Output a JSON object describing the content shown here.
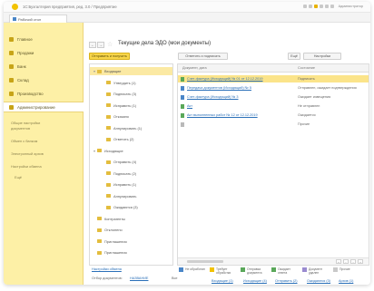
{
  "app": {
    "title": "1С:Бухгалтерия предприятия, ред. 3.0 / Предприятие",
    "user": "Администратор",
    "tab_label": "Рабочий стол"
  },
  "sidebar": {
    "items": [
      {
        "label": "Главное"
      },
      {
        "label": "Продажи"
      },
      {
        "label": "Банк"
      },
      {
        "label": "Склад"
      },
      {
        "label": "Производство"
      },
      {
        "label": "Администрирование"
      }
    ],
    "links": [
      "Общие настройки",
      "документов",
      "Обмен с банком",
      "Электронный архив",
      "Настройки обмена",
      "Ещё"
    ]
  },
  "main": {
    "nav_back": "←",
    "nav_forward": "→",
    "title": "Текущие дела ЭДО (мои документы)",
    "toolbar": {
      "create_label": "Отправить и получить",
      "middle_label": "Ответить и подписать",
      "more_label": "Ещё",
      "settings_label": "Настройки"
    },
    "tree": {
      "items": [
        {
          "label": "Входящие",
          "twisty": "▾",
          "indent": 0,
          "selected": true
        },
        {
          "label": "Утвердить (1)",
          "twisty": "",
          "indent": 1,
          "selected": false
        },
        {
          "label": "Подписать (3)",
          "twisty": "",
          "indent": 1,
          "selected": false
        },
        {
          "label": "Исправить (1)",
          "twisty": "",
          "indent": 1,
          "selected": false
        },
        {
          "label": "Отказано",
          "twisty": "",
          "indent": 1,
          "selected": false
        },
        {
          "label": "Аннулировать (1)",
          "twisty": "",
          "indent": 1,
          "selected": false
        },
        {
          "label": "Ответить (2)",
          "twisty": "",
          "indent": 1,
          "selected": false
        },
        {
          "label": "Исходящие",
          "twisty": "▾",
          "indent": 0,
          "selected": false
        },
        {
          "label": "Отправить (4)",
          "twisty": "",
          "indent": 1,
          "selected": false
        },
        {
          "label": "Подписать (2)",
          "twisty": "",
          "indent": 1,
          "selected": false
        },
        {
          "label": "Исправить (1)",
          "twisty": "",
          "indent": 1,
          "selected": false
        },
        {
          "label": "Аннулировать",
          "twisty": "",
          "indent": 1,
          "selected": false
        },
        {
          "label": "Ожидаются (3)",
          "twisty": "",
          "indent": 1,
          "selected": false
        },
        {
          "label": "Контрагенты",
          "twisty": "",
          "indent": 0,
          "selected": false
        },
        {
          "label": "Отклонено",
          "twisty": "",
          "indent": 0,
          "selected": false
        },
        {
          "label": "Приглашения",
          "twisty": "",
          "indent": 0,
          "selected": false
        },
        {
          "label": "Приглашения",
          "twisty": "",
          "indent": 0,
          "selected": false
        }
      ]
    },
    "list": {
      "col_document": "Документ, дата",
      "col_status": "Состояние",
      "rows": [
        {
          "name": "Счет-фактура (Исходящий) № 01 от 12.12.2019",
          "status": "Подписать",
          "selected": true,
          "icon": "green"
        },
        {
          "name": "Передача документов (Исходящий) № 5",
          "status": "Отправлен, ожидает подтверждения",
          "selected": false,
          "icon": "blue"
        },
        {
          "name": "Счет-фактура (Исходящий) № 3",
          "status": "Ожидает извещения",
          "selected": false,
          "icon": "blue"
        },
        {
          "name": "Акт",
          "status": "Не отправлен",
          "selected": false,
          "icon": "green"
        },
        {
          "name": "Акт выполненных работ № 12 от 12.12.2019",
          "status": "Ожидается",
          "selected": false,
          "icon": "green"
        },
        {
          "name": "",
          "status": "Прочие",
          "selected": false,
          "icon": "grey"
        }
      ],
      "pager": [
        "«",
        "‹",
        "›",
        "»"
      ]
    },
    "bottom": {
      "link1": "Настройки обмена",
      "link2_label": "Отбор документов:",
      "link2_value": "НАЗВАНИЕ",
      "link3": "Все",
      "legend": [
        {
          "text": "Не обработан",
          "color": "#4a86c8"
        },
        {
          "text": "Требует обработки",
          "color": "#f2c200"
        },
        {
          "text": "Отправка документа",
          "color": "#5aa85a"
        },
        {
          "text": "Ожидает ответа",
          "color": "#5aa85a"
        },
        {
          "text": "Документ удален",
          "color": "#9a8bd0"
        },
        {
          "text": "Прочие",
          "color": "#c9c9c9"
        }
      ],
      "footer_links": [
        "Входящие (1)",
        "Исходящие (4)",
        "Отправить (2)",
        "Ожидаются (3)",
        "Архив (1)"
      ]
    }
  }
}
